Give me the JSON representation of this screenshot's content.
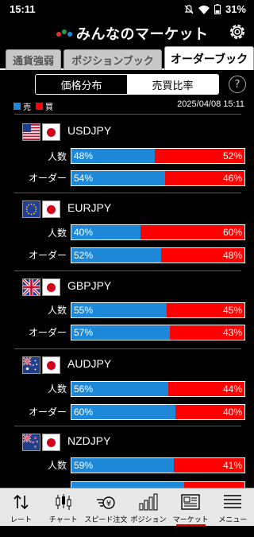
{
  "status": {
    "time": "15:11",
    "battery": "31%"
  },
  "app": {
    "title": "みんなのマーケット"
  },
  "tabs": [
    {
      "label": "通貨強弱"
    },
    {
      "label": "ポジションブック"
    },
    {
      "label": "オーダーブック"
    }
  ],
  "segment": {
    "left": "価格分布",
    "right": "売買比率"
  },
  "help": "?",
  "legend": {
    "sell": "売",
    "buy": "買",
    "sell_color": "#1e88d8",
    "buy_color": "#ff0000"
  },
  "timestamp": "2025/04/08 15:11",
  "row_labels": {
    "people": "人数",
    "order": "オーダー"
  },
  "pairs": [
    {
      "name": "USDJPY",
      "flag": "us-flag-icon",
      "people": {
        "sell": "48%",
        "buy": "52%",
        "sell_pct": 48
      },
      "order": {
        "sell": "54%",
        "buy": "46%",
        "sell_pct": 54
      }
    },
    {
      "name": "EURJPY",
      "flag": "eu-flag-icon",
      "people": {
        "sell": "40%",
        "buy": "60%",
        "sell_pct": 40
      },
      "order": {
        "sell": "52%",
        "buy": "48%",
        "sell_pct": 52
      }
    },
    {
      "name": "GBPJPY",
      "flag": "uk-flag-icon",
      "people": {
        "sell": "55%",
        "buy": "45%",
        "sell_pct": 55
      },
      "order": {
        "sell": "57%",
        "buy": "43%",
        "sell_pct": 57
      }
    },
    {
      "name": "AUDJPY",
      "flag": "au-flag-icon",
      "people": {
        "sell": "56%",
        "buy": "44%",
        "sell_pct": 56
      },
      "order": {
        "sell": "60%",
        "buy": "40%",
        "sell_pct": 60
      }
    },
    {
      "name": "NZDJPY",
      "flag": "nz-flag-icon",
      "people": {
        "sell": "59%",
        "buy": "41%",
        "sell_pct": 59
      },
      "order": {
        "sell": "",
        "buy": "",
        "sell_pct": 65
      }
    }
  ],
  "nav": [
    {
      "label": "レート",
      "icon": "rate-arrows-icon"
    },
    {
      "label": "チャート",
      "icon": "candlestick-icon"
    },
    {
      "label": "スピード注文",
      "icon": "speed-order-icon"
    },
    {
      "label": "ポジション",
      "icon": "position-bars-icon"
    },
    {
      "label": "マーケット",
      "icon": "newspaper-icon"
    },
    {
      "label": "メニュー",
      "icon": "menu-icon"
    }
  ]
}
